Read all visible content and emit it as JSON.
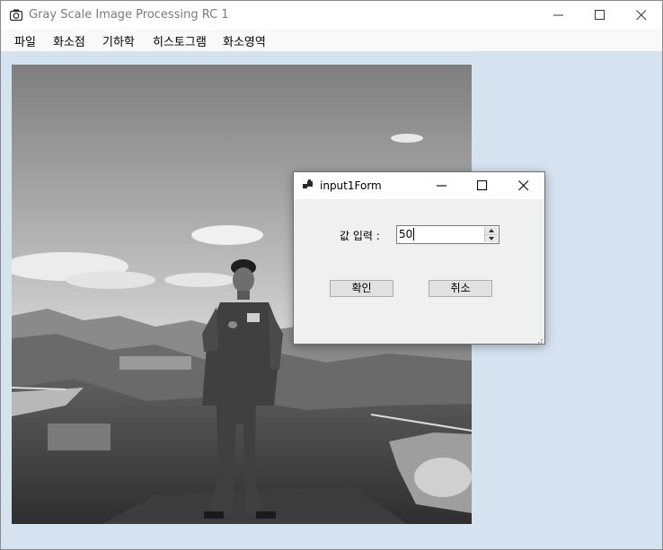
{
  "window": {
    "title": "Gray Scale Image Processing RC 1"
  },
  "menu": {
    "items": [
      "파일",
      "화소점",
      "기하학",
      "히스토그램",
      "화소영역"
    ]
  },
  "dialog": {
    "title": "input1Form",
    "value_label": "값 입력 :",
    "value": "50",
    "ok_label": "확인",
    "cancel_label": "취소"
  }
}
